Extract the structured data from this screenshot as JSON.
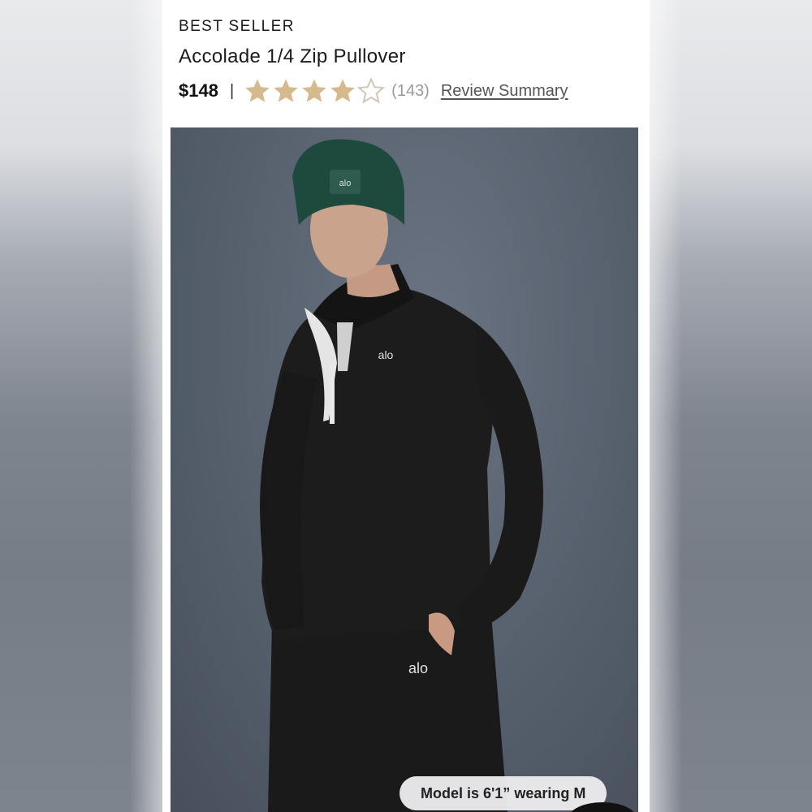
{
  "product": {
    "badge": "BEST SELLER",
    "title": "Accolade 1/4 Zip Pullover",
    "price": "$148",
    "divider": "|",
    "rating": {
      "value": 4,
      "max": 5,
      "filled_color": "#d7b98e",
      "empty_color": "#cfc6b8"
    },
    "review_count": "(143)",
    "review_link": "Review Summary"
  },
  "image": {
    "logo_hat": "alo",
    "logo_chest": "alo",
    "logo_pants": "alo"
  },
  "model_info": "Model is 6'1” wearing M"
}
